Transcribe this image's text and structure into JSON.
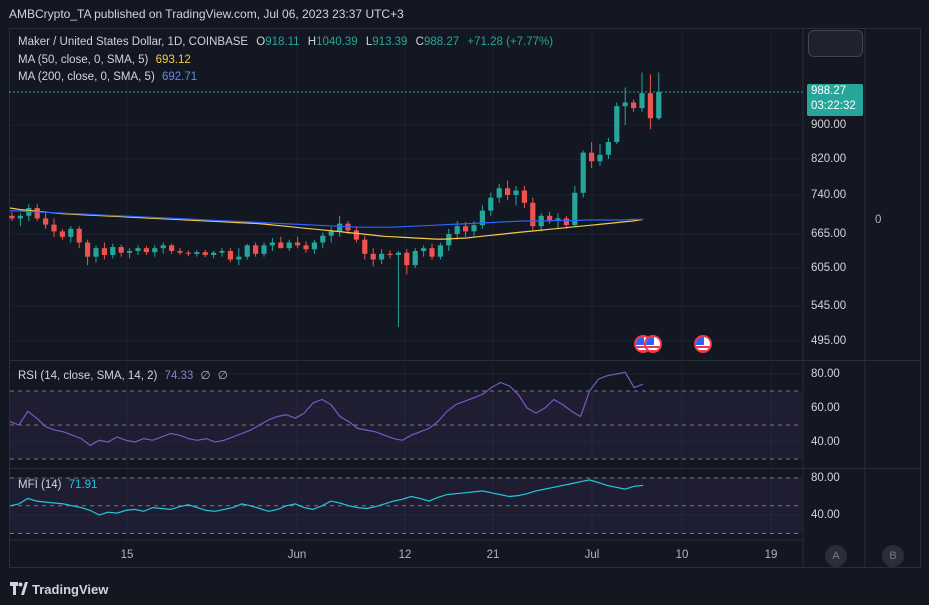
{
  "header": {
    "published": "AMBCrypto_TA published on TradingView.com, Jul 06, 2023 23:37 UTC+3"
  },
  "main_legend": {
    "symbol": "Maker / United States Dollar, 1D, COINBASE",
    "open_label": "O",
    "open": "918.11",
    "high_label": "H",
    "high": "1040.39",
    "low_label": "L",
    "low": "913.39",
    "close_label": "C",
    "close": "988.27",
    "change": "+71.28 (+7.77%)",
    "ma50_label": "MA (50, close, 0, SMA, 5)",
    "ma50_value": "693.12",
    "ma200_label": "MA (200, close, 0, SMA, 5)",
    "ma200_value": "692.71"
  },
  "price_axis": {
    "labels": [
      "900.00",
      "820.00",
      "740.00",
      "665.00",
      "605.00",
      "545.00",
      "495.00"
    ],
    "current_price": "988.27",
    "countdown": "03:22:32",
    "right_value": "0"
  },
  "rsi_legend": {
    "label": "RSI (14, close, SMA, 14, 2)",
    "value": "74.33",
    "extra1": "∅",
    "extra2": "∅"
  },
  "rsi_axis": [
    "80.00",
    "60.00",
    "40.00"
  ],
  "mfi_legend": {
    "label": "MFI (14)",
    "value": "71.91"
  },
  "mfi_axis": [
    "80.00",
    "40.00"
  ],
  "time_axis": [
    "15",
    "Jun",
    "12",
    "21",
    "Jul",
    "10",
    "19"
  ],
  "corner_buttons": {
    "a": "A",
    "b": "B"
  },
  "footer": {
    "brand": "TradingView"
  },
  "colors": {
    "up": "#26a69a",
    "down": "#ef5350",
    "ma50": "#f7c948",
    "ma200": "#2962ff",
    "rsi": "#7e57c2",
    "mfi": "#26c6da"
  },
  "chart_data": {
    "type": "candlestick",
    "title": "Maker / United States Dollar, 1D, COINBASE",
    "x_ticks": [
      "15",
      "Jun",
      "12",
      "21",
      "Jul",
      "10",
      "19"
    ],
    "y_ticks": [
      900,
      820,
      740,
      665,
      605,
      545,
      495
    ],
    "candles_ohlc": [
      [
        700,
        708,
        690,
        695
      ],
      [
        695,
        705,
        680,
        700
      ],
      [
        700,
        722,
        690,
        715
      ],
      [
        715,
        722,
        690,
        695
      ],
      [
        695,
        705,
        675,
        683
      ],
      [
        683,
        695,
        660,
        670
      ],
      [
        670,
        675,
        655,
        660
      ],
      [
        660,
        680,
        650,
        675
      ],
      [
        675,
        680,
        640,
        650
      ],
      [
        650,
        655,
        610,
        625
      ],
      [
        625,
        645,
        615,
        640
      ],
      [
        640,
        650,
        620,
        628
      ],
      [
        628,
        648,
        622,
        642
      ],
      [
        642,
        646,
        625,
        632
      ],
      [
        632,
        640,
        622,
        635
      ],
      [
        635,
        645,
        628,
        640
      ],
      [
        640,
        644,
        628,
        633
      ],
      [
        633,
        645,
        625,
        640
      ],
      [
        640,
        650,
        630,
        645
      ],
      [
        645,
        648,
        630,
        635
      ],
      [
        635,
        640,
        628,
        632
      ],
      [
        632,
        636,
        626,
        630
      ],
      [
        630,
        636,
        625,
        633
      ],
      [
        633,
        637,
        624,
        628
      ],
      [
        628,
        635,
        622,
        632
      ],
      [
        632,
        640,
        625,
        635
      ],
      [
        635,
        640,
        615,
        620
      ],
      [
        620,
        640,
        610,
        625
      ],
      [
        625,
        648,
        620,
        645
      ],
      [
        645,
        650,
        625,
        630
      ],
      [
        630,
        650,
        625,
        645
      ],
      [
        645,
        658,
        635,
        650
      ],
      [
        650,
        660,
        640,
        640
      ],
      [
        640,
        655,
        635,
        650
      ],
      [
        650,
        660,
        640,
        645
      ],
      [
        645,
        652,
        632,
        638
      ],
      [
        638,
        655,
        630,
        650
      ],
      [
        650,
        668,
        640,
        662
      ],
      [
        662,
        678,
        650,
        670
      ],
      [
        670,
        700,
        660,
        685
      ],
      [
        685,
        690,
        665,
        672
      ],
      [
        672,
        680,
        650,
        655
      ],
      [
        655,
        662,
        620,
        630
      ],
      [
        630,
        640,
        608,
        620
      ],
      [
        620,
        638,
        612,
        630
      ],
      [
        630,
        636,
        622,
        628
      ],
      [
        628,
        635,
        515,
        632
      ],
      [
        632,
        638,
        595,
        610
      ],
      [
        610,
        640,
        605,
        635
      ],
      [
        635,
        645,
        625,
        640
      ],
      [
        640,
        648,
        620,
        625
      ],
      [
        625,
        650,
        620,
        645
      ],
      [
        645,
        675,
        635,
        665
      ],
      [
        665,
        690,
        655,
        680
      ],
      [
        680,
        688,
        660,
        670
      ],
      [
        670,
        690,
        660,
        682
      ],
      [
        682,
        720,
        675,
        710
      ],
      [
        710,
        745,
        700,
        735
      ],
      [
        735,
        765,
        725,
        755
      ],
      [
        755,
        772,
        730,
        740
      ],
      [
        740,
        760,
        720,
        750
      ],
      [
        750,
        760,
        715,
        725
      ],
      [
        725,
        735,
        670,
        680
      ],
      [
        680,
        705,
        670,
        700
      ],
      [
        700,
        708,
        685,
        690
      ],
      [
        690,
        705,
        675,
        695
      ],
      [
        695,
        700,
        675,
        682
      ],
      [
        682,
        760,
        678,
        745
      ],
      [
        745,
        840,
        735,
        835
      ],
      [
        835,
        860,
        800,
        815
      ],
      [
        815,
        855,
        805,
        830
      ],
      [
        830,
        870,
        820,
        860
      ],
      [
        860,
        960,
        855,
        950
      ],
      [
        950,
        1000,
        900,
        960
      ],
      [
        960,
        968,
        935,
        945
      ],
      [
        945,
        1040,
        935,
        985
      ],
      [
        985,
        1035,
        890,
        918
      ],
      [
        918,
        1040,
        913,
        988
      ]
    ],
    "ma50": [
      715,
      712,
      710,
      708,
      706,
      704,
      703,
      702,
      701,
      700,
      699,
      698,
      697,
      696,
      695,
      694,
      693,
      692,
      691,
      690,
      689,
      688,
      687,
      686,
      685,
      683,
      681,
      679,
      677,
      675,
      673,
      671,
      669,
      667,
      665,
      663,
      661,
      660,
      659,
      658,
      657,
      656,
      656,
      657,
      658,
      660,
      662,
      664,
      666,
      668,
      670,
      672,
      674,
      676,
      678,
      680,
      682,
      684,
      686,
      688,
      690,
      693
    ],
    "ma200": [
      710,
      709,
      708,
      707,
      706,
      705,
      704,
      703,
      702,
      701,
      700,
      699,
      698,
      697,
      696,
      695,
      694,
      693,
      692,
      691,
      690,
      689,
      688,
      687,
      686,
      685,
      684,
      683,
      682,
      681,
      680,
      679,
      678,
      678,
      678,
      678,
      679,
      680,
      681,
      682,
      683,
      684,
      685,
      686,
      687,
      688,
      689,
      690,
      690,
      690,
      691,
      691,
      691,
      692,
      692,
      692,
      692,
      693,
      693
    ],
    "rsi_values": [
      52,
      50,
      58,
      54,
      49,
      47,
      46,
      44,
      42,
      38,
      41,
      40,
      43,
      41,
      40,
      42,
      41,
      43,
      45,
      44,
      42,
      41,
      42,
      40,
      41,
      43,
      45,
      47,
      50,
      53,
      55,
      56,
      54,
      57,
      63,
      65,
      62,
      55,
      52,
      48,
      47,
      46,
      44,
      42,
      41,
      44,
      46,
      48,
      52,
      58,
      62,
      64,
      66,
      68,
      72,
      75,
      73,
      68,
      60,
      57,
      60,
      65,
      62,
      58,
      55,
      70,
      77,
      79,
      80,
      81,
      72,
      74
    ],
    "rsi_ylim": [
      20,
      90
    ],
    "mfi_values": [
      50,
      52,
      58,
      55,
      54,
      53,
      52,
      50,
      48,
      45,
      40,
      43,
      42,
      45,
      46,
      44,
      48,
      47,
      46,
      49,
      51,
      48,
      45,
      44,
      46,
      48,
      52,
      50,
      47,
      44,
      46,
      50,
      52,
      48,
      46,
      50,
      55,
      53,
      50,
      48,
      47,
      49,
      52,
      55,
      57,
      60,
      58,
      55,
      59,
      62,
      63,
      64,
      65,
      66,
      64,
      62,
      60,
      61,
      63,
      66,
      68,
      70,
      72,
      74,
      76,
      78,
      75,
      72,
      70,
      68,
      71,
      72
    ],
    "mfi_ylim": [
      10,
      90
    ]
  }
}
